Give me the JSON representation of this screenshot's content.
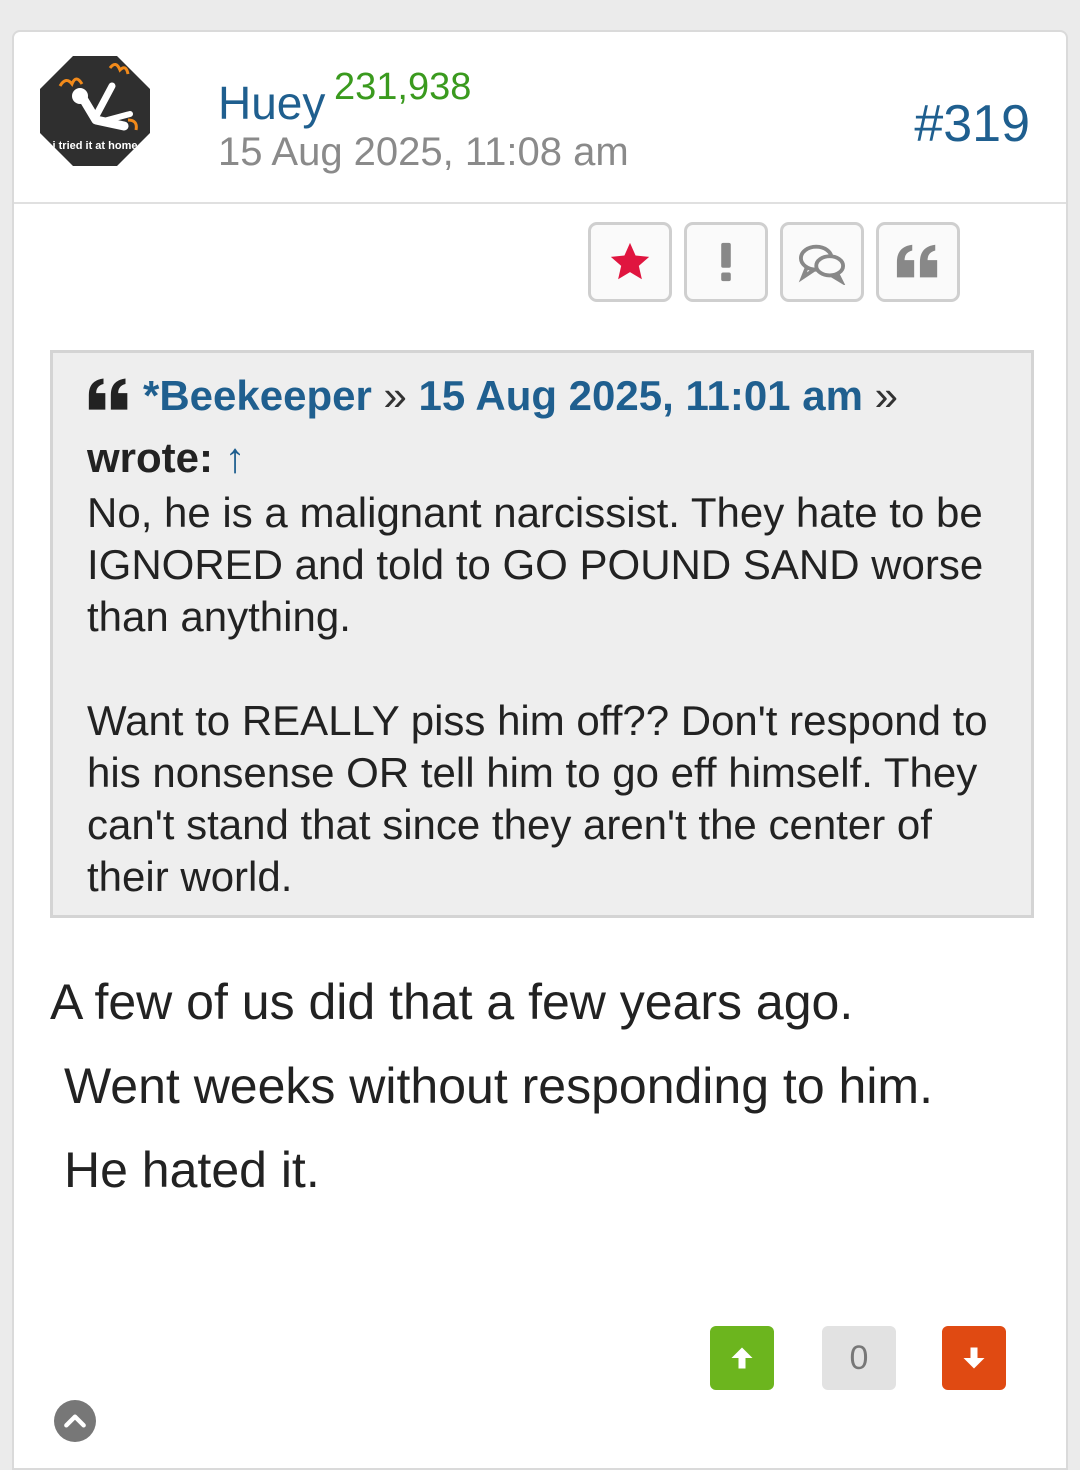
{
  "post": {
    "avatar_caption": "i tried it at home",
    "username": "Huey",
    "points": "231,938",
    "date": "15 Aug 2025, 11:08 am",
    "number": "#319"
  },
  "actions": [
    {
      "icon": "star-icon",
      "color": "#e0153f"
    },
    {
      "icon": "exclamation-icon",
      "color": "#888888"
    },
    {
      "icon": "chat-bubbles-icon",
      "color": "#888888"
    },
    {
      "icon": "quote-icon",
      "color": "#888888"
    }
  ],
  "quote": {
    "author": "*Beekeeper",
    "separator": "»",
    "date": "15 Aug 2025, 11:01 am",
    "wrote": "wrote:",
    "arrow": "↑",
    "paragraph1": "No, he is a malignant narcissist. They hate to be IGNORED and told to GO POUND SAND worse than anything.",
    "paragraph2": "Want to REALLY piss him off?? Don't respond to his nonsense OR tell him to go eff himself. They can't stand that since they aren't the center of their world."
  },
  "body": {
    "line1": "A few of us did that a few years ago.",
    "line2": "Went weeks without responding to him.",
    "line3": "He hated it."
  },
  "votes": {
    "count": "0",
    "up_color": "#6cb51e",
    "down_color": "#e04a12"
  }
}
